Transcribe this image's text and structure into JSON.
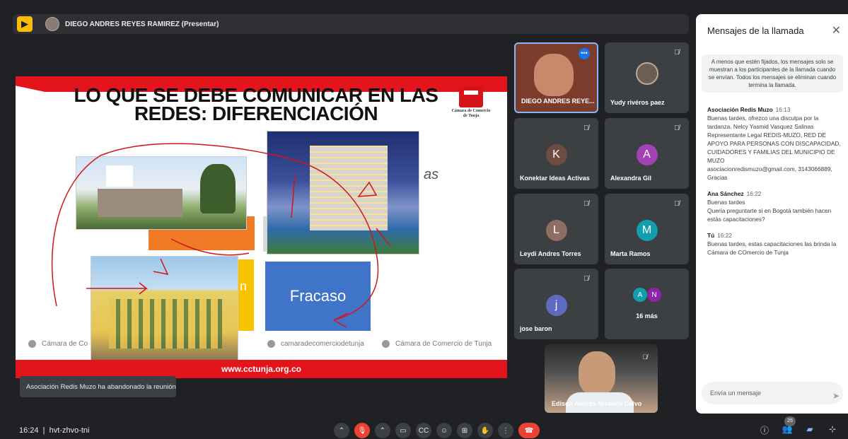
{
  "presenter_bar": {
    "title": "DIEGO ANDRES REYES RAMIREZ (Presentar)"
  },
  "slide": {
    "title": "LO QUE SE DEBE COMUNICAR EN LAS REDES: DIFERENCIACIÓN",
    "logo_text": "Cámara de Comercio de Tunja",
    "box_fracaso": "Fracaso",
    "box_yellow_partial": "n",
    "side_text_partial": "as",
    "footer": {
      "facebook": "Cámara de Co",
      "instagram": "camaradecomerciodetunja",
      "youtube": "Cámara de Comercio de Tunja"
    },
    "url": "www.cctunja.org.co"
  },
  "toast": {
    "text": "Asociación Redis Muzo ha abandonado la reunión"
  },
  "participants": [
    {
      "name": "DIEGO ANDRES REYE...",
      "type": "video",
      "active": true
    },
    {
      "name": "Yudy rivéros paez",
      "type": "photo",
      "muted": true
    },
    {
      "name": "Konektar Ideas Activas",
      "initial": "K",
      "color": "#6d4c41",
      "muted": true
    },
    {
      "name": "Alexandra Gil",
      "initial": "A",
      "color": "#a142b5",
      "muted": true
    },
    {
      "name": "Leydi Andres Torres",
      "initial": "L",
      "color": "#8d6e63",
      "muted": true
    },
    {
      "name": "Marta Ramos",
      "initial": "M",
      "color": "#129eaf",
      "muted": true
    },
    {
      "name": "jose baron",
      "initial": "j",
      "color": "#5c6bc0",
      "muted": true
    },
    {
      "more_label": "16 más",
      "stack": [
        {
          "initial": "A",
          "color": "#129eaf"
        },
        {
          "initial": "N",
          "color": "#8e24aa"
        }
      ]
    }
  ],
  "self_view": {
    "name": "Edison Andres Miranda Calvo"
  },
  "chat": {
    "title": "Mensajes de la llamada",
    "notice": "A menos que estén fijados, los mensajes solo se muestran a los participantes de la llamada cuando se envían. Todos los mensajes se eliminan cuando termina la llamada.",
    "messages": [
      {
        "author": "Asociación Redis Muzo",
        "time": "16:13",
        "lines": [
          "Buenas tardes, ofrezco una disculpa por la tardanza. Nelcy Yasmid Vasquez Salinas Representante Legal REDIS-MUZO, RED DE APOYO PARA PERSONAS CON DISCAPACIDAD, CUIDADORES Y FAMILIAS DEL MUNICIPIO DE MUZO",
          "asociacionredismuzo@gmail.com, 3143066889, Gracias"
        ]
      },
      {
        "author": "Ana Sánchez",
        "time": "16:22",
        "lines": [
          "Buenas tardes",
          "Quería preguntarte si en Bogotá también hacen estás capacitaciones?"
        ]
      },
      {
        "author": "Tú",
        "time": "16:22",
        "lines": [
          "Buenas tardes, estas capacitaciones las brinda la Cámara de COmercio de Tunja"
        ]
      }
    ],
    "input_placeholder": "Envía un mensaje"
  },
  "bottom_bar": {
    "time": "16:24",
    "meeting_code": "hvt-zhvo-tni",
    "participant_count": "25"
  },
  "colors": {
    "background": "#202124",
    "accent_blue": "#8ab4f8",
    "danger": "#ea4335",
    "slide_red": "#e3141b"
  }
}
